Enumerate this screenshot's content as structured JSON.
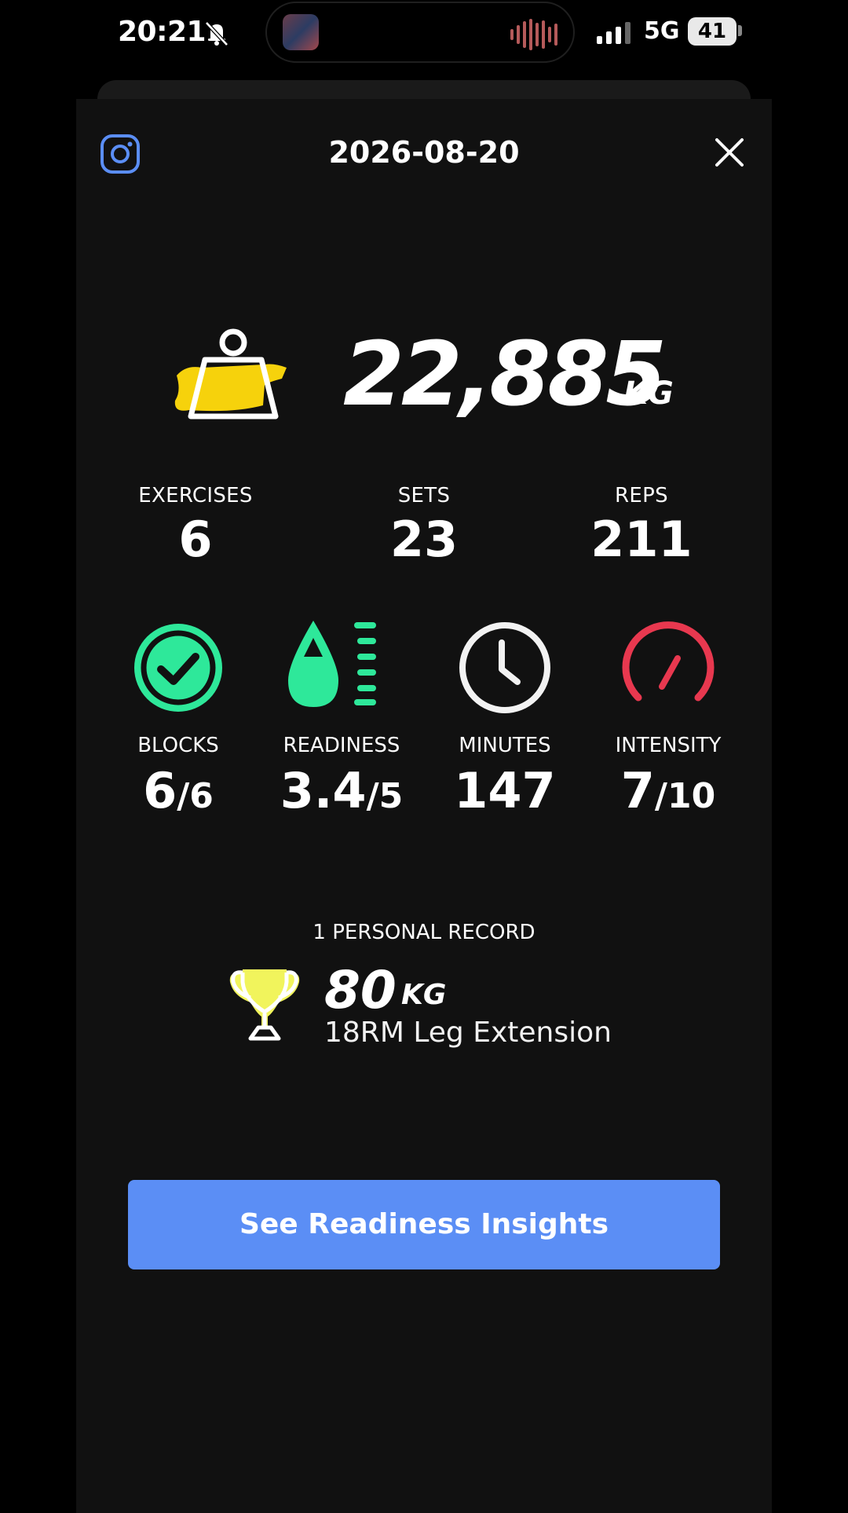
{
  "status_bar": {
    "time": "20:21",
    "network": "5G",
    "battery": "41"
  },
  "header": {
    "date": "2026-08-20",
    "instagram_icon": "instagram-icon",
    "close_icon": "close-icon"
  },
  "total": {
    "value": "22,885",
    "unit": "KG",
    "icon": "weight-icon"
  },
  "summary": [
    {
      "label": "EXERCISES",
      "value": "6"
    },
    {
      "label": "SETS",
      "value": "23"
    },
    {
      "label": "REPS",
      "value": "211"
    }
  ],
  "metrics": [
    {
      "label": "BLOCKS",
      "value": "6",
      "denominator": "/6",
      "icon": "checkmark-icon"
    },
    {
      "label": "READINESS",
      "value": "3.4",
      "denominator": "/5",
      "icon": "drop-icon"
    },
    {
      "label": "MINUTES",
      "value": "147",
      "denominator": "",
      "icon": "clock-icon"
    },
    {
      "label": "INTENSITY",
      "value": "7",
      "denominator": "/10",
      "icon": "gauge-icon"
    }
  ],
  "personal_record": {
    "label": "1 PERSONAL RECORD",
    "weight": "80",
    "unit": "KG",
    "exercise": "18RM Leg Extension",
    "icon": "trophy-icon"
  },
  "cta": {
    "label": "See Readiness Insights"
  },
  "colors": {
    "accent_blue": "#5b8ef5",
    "green": "#2ee89a",
    "red": "#e8384f",
    "yellow": "#f6d20c",
    "sheet_bg": "#111111"
  }
}
